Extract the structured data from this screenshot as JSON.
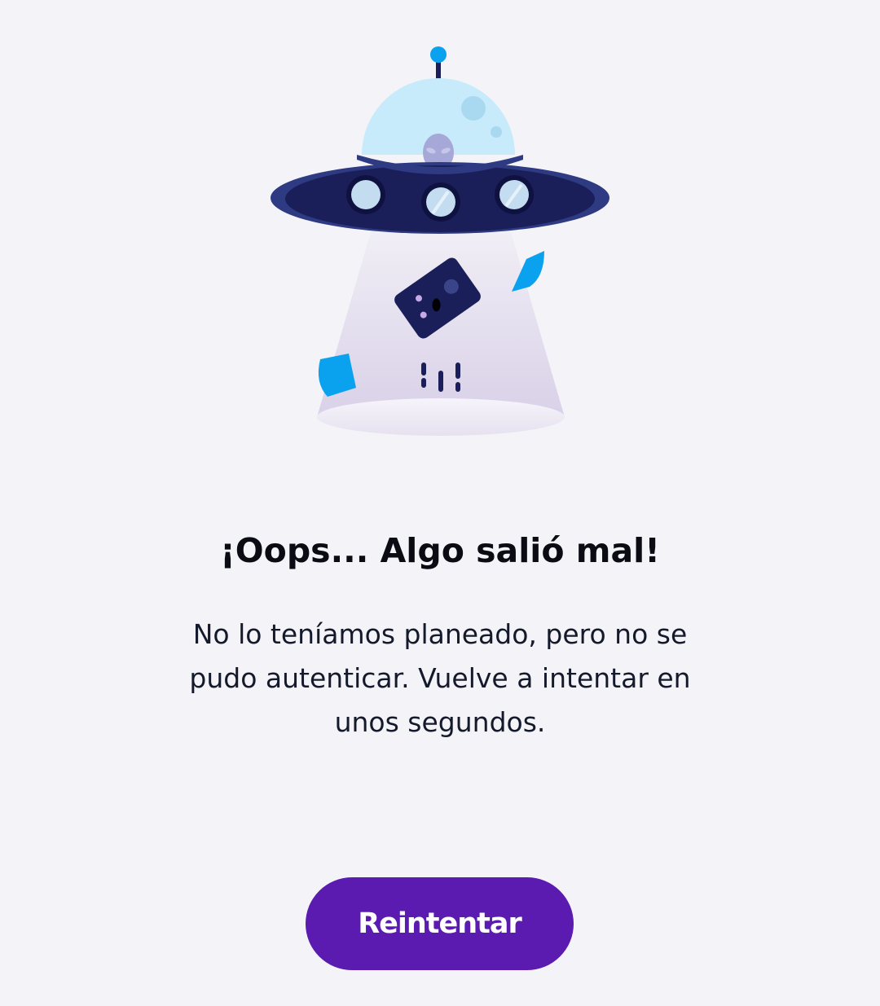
{
  "error_screen": {
    "illustration_icon": "ufo-abducting-card-icon",
    "title": "¡Oops... Algo salió mal!",
    "message": "No lo teníamos planeado, pero no se pudo autenticar. Vuelve a intentar en unos segundos.",
    "retry_button_label": "Reintentar"
  },
  "colors": {
    "background": "#f4f4f8",
    "ufo_body": "#1a1f5a",
    "dome": "#c7ebfb",
    "accent_blue": "#0aa2ef",
    "button": "#5b1ab0",
    "beam": "#ddd6ea"
  }
}
